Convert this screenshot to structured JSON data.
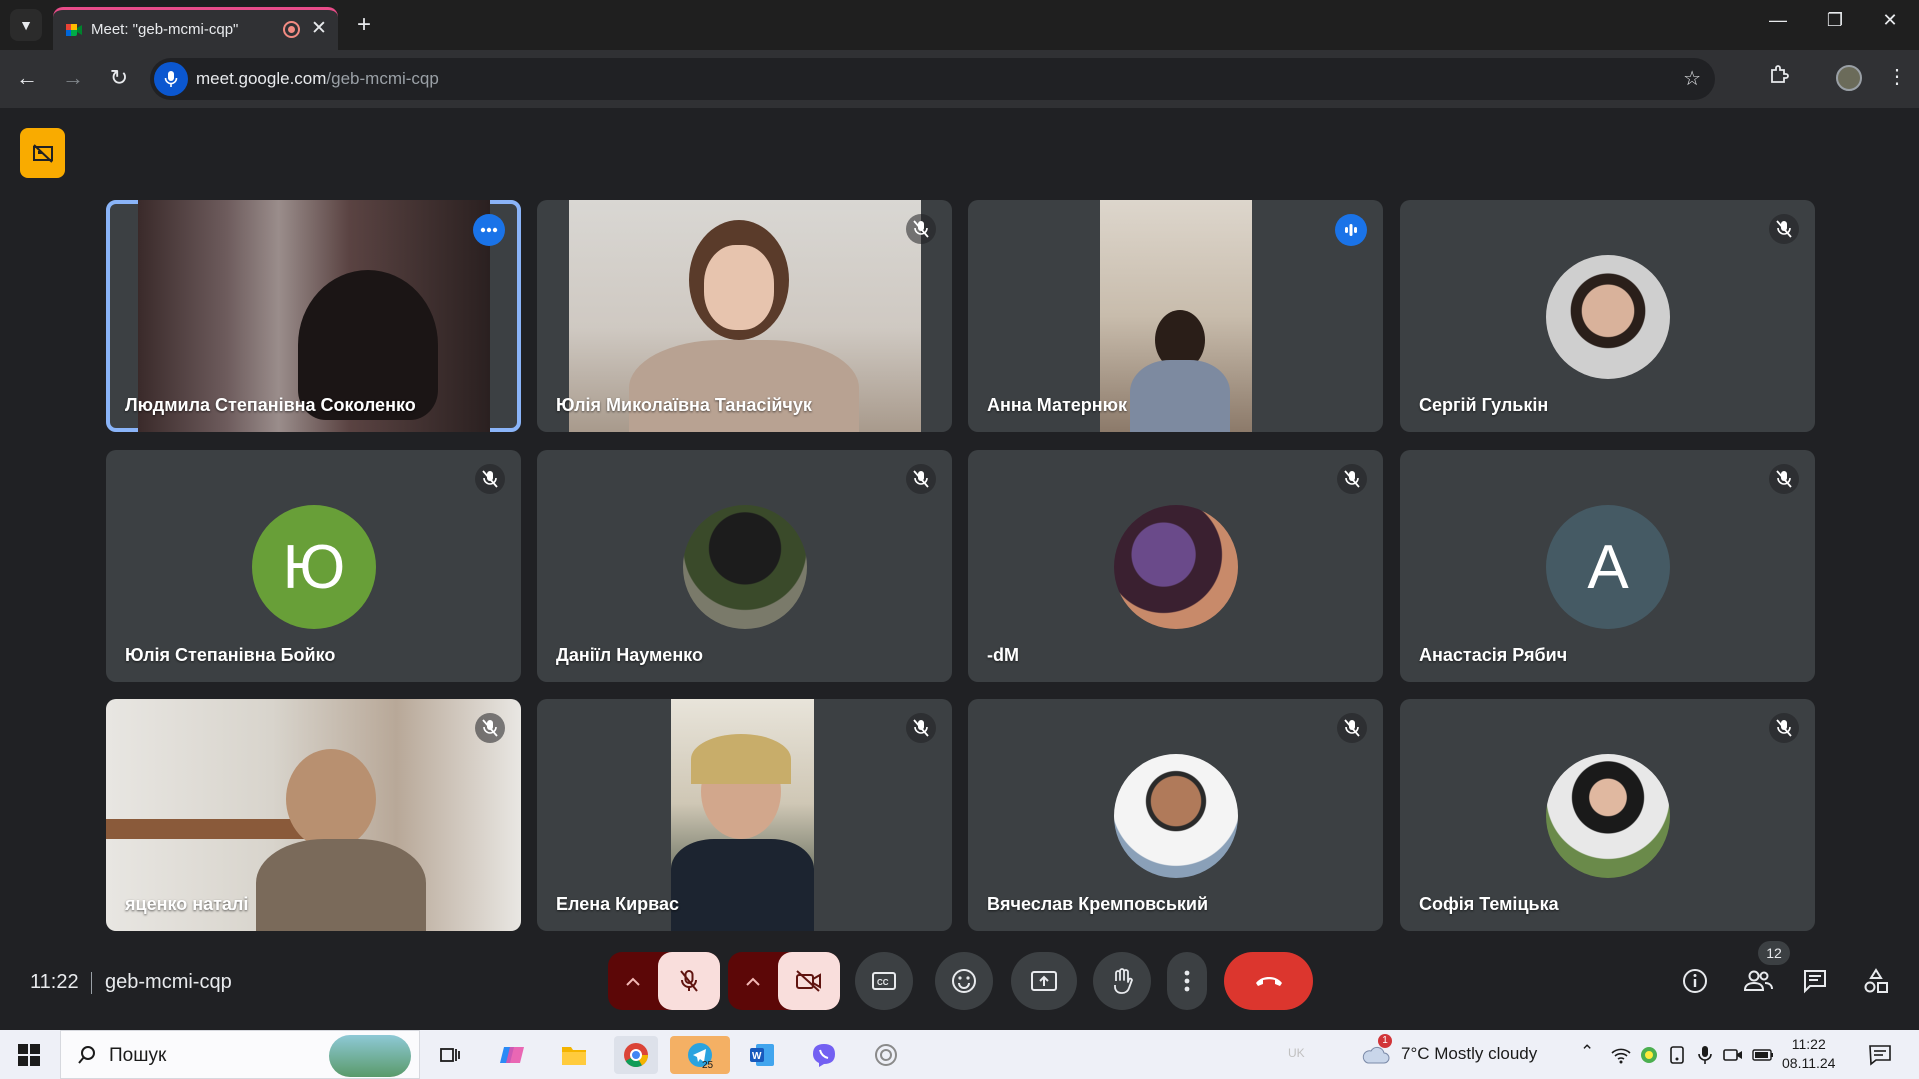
{
  "browser": {
    "tab_title": "Meet: \"geb-mcmi-cqp\"",
    "url_host": "meet.google.com",
    "url_path": "/geb-mcmi-cqp"
  },
  "participants": [
    {
      "name": "Людмила Степанівна Соколенко",
      "mic": "more",
      "avatar": "video"
    },
    {
      "name": "Юлія Миколаївна Танасійчук",
      "mic": "muted",
      "avatar": "video"
    },
    {
      "name": "Анна Матернюк",
      "mic": "speaking",
      "avatar": "video"
    },
    {
      "name": "Сергій Гулькін",
      "mic": "muted",
      "avatar": "photo"
    },
    {
      "name": "Юлія Степанівна Бойко",
      "mic": "muted",
      "avatar": "Ю",
      "color": "#689f38"
    },
    {
      "name": "Даніїл Науменко",
      "mic": "muted",
      "avatar": "photo"
    },
    {
      "name": "-dM",
      "mic": "muted",
      "avatar": "photo"
    },
    {
      "name": "Анастасія Рябич",
      "mic": "muted",
      "avatar": "А",
      "color": "#455a64"
    },
    {
      "name": "яценко наталі",
      "mic": "muted",
      "avatar": "video"
    },
    {
      "name": "Елена Кирвас",
      "mic": "muted",
      "avatar": "video"
    },
    {
      "name": "Вячеслав Кремповський",
      "mic": "muted",
      "avatar": "photo"
    },
    {
      "name": "Софія Теміцька",
      "mic": "muted",
      "avatar": "photo"
    }
  ],
  "meeting": {
    "time": "11:22",
    "code": "geb-mcmi-cqp",
    "participant_count": "12"
  },
  "taskbar": {
    "search_placeholder": "Пошук",
    "weather": "7°C  Mostly cloudy",
    "lang": "UK",
    "clock_time": "11:22",
    "clock_date": "08.11.24",
    "telegram_badge": "25",
    "weather_badge": "1"
  }
}
